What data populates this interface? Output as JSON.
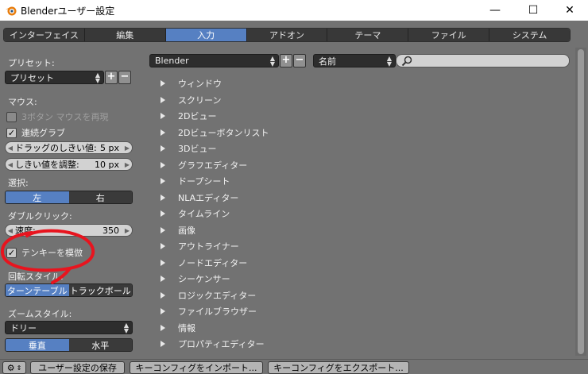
{
  "window": {
    "title": "Blenderユーザー設定",
    "min": "—",
    "max": "☐",
    "close": "✕"
  },
  "tabs": [
    {
      "label": "インターフェイス",
      "active": false
    },
    {
      "label": "編集",
      "active": false
    },
    {
      "label": "入力",
      "active": true
    },
    {
      "label": "アドオン",
      "active": false
    },
    {
      "label": "テーマ",
      "active": false
    },
    {
      "label": "ファイル",
      "active": false
    },
    {
      "label": "システム",
      "active": false
    }
  ],
  "left": {
    "preset_label": "プリセット:",
    "preset_value": "プリセット",
    "mouse_label": "マウス:",
    "emulate3": "3ボタン マウスを再現",
    "continuous_grab": "連続グラブ",
    "drag_threshold_label": "ドラッグのしきい値:",
    "drag_threshold_value": "5 px",
    "tweak_threshold_label": "しきい値を調整:",
    "tweak_threshold_value": "10 px",
    "select_label": "選択:",
    "select_left": "左",
    "select_right": "右",
    "dblclick_label": "ダブルクリック:",
    "speed_label": "速度:",
    "speed_value": "350",
    "numpad_emulate": "テンキーを模倣",
    "orbit_label": "回転スタイル:",
    "orbit_turntable": "ターンテーブル",
    "orbit_trackball": "トラックボール",
    "zoom_label": "ズームスタイル:",
    "zoom_value": "ドリー",
    "zoom_vertical": "垂直",
    "zoom_horizontal": "水平"
  },
  "keymap": {
    "preset": "Blender",
    "filter_type": "名前",
    "search_placeholder": ""
  },
  "editors": [
    "ウィンドウ",
    "スクリーン",
    "2Dビュー",
    "2Dビューボタンリスト",
    "3Dビュー",
    "グラフエディター",
    "ドープシート",
    "NLAエディター",
    "タイムライン",
    "画像",
    "アウトライナー",
    "ノードエディター",
    "シーケンサー",
    "ロジックエディター",
    "ファイルブラウザー",
    "情報",
    "プロパティエディター"
  ],
  "bottom": {
    "save": "ユーザー設定の保存",
    "import": "キーコンフィグをインポート...",
    "export": "キーコンフィグをエクスポート..."
  },
  "colors": {
    "accent": "#5680c2",
    "annotation": "#e8141e"
  }
}
